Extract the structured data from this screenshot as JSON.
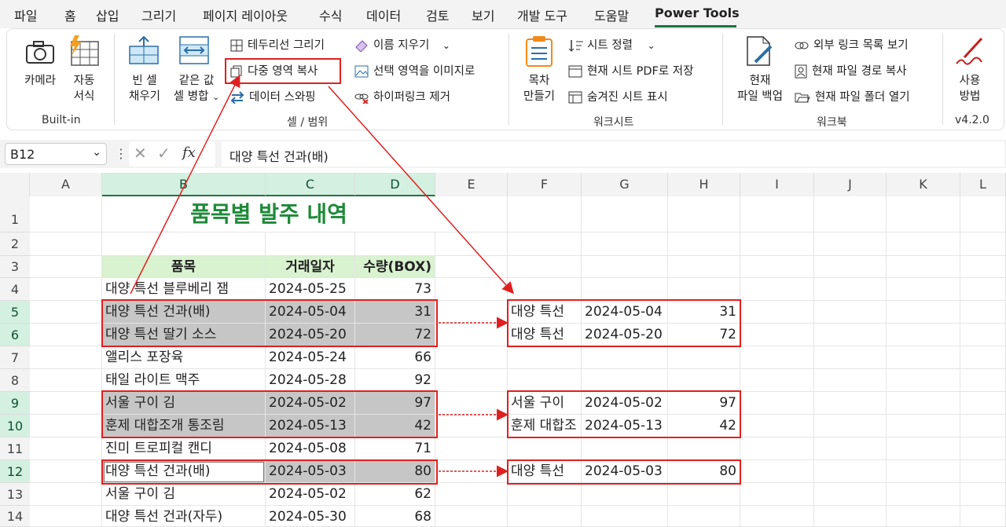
{
  "tabs": [
    "파일",
    "홈",
    "삽입",
    "그리기",
    "페이지 레이아웃",
    "수식",
    "데이터",
    "검토",
    "보기",
    "개발 도구",
    "도움말",
    "Power Tools"
  ],
  "ribbon": {
    "camera": "카메라",
    "auto_format": "자동\n서식",
    "builtin": "Built-in",
    "fill_blank_1": "빈 셀",
    "fill_blank_2": "채우기",
    "merge_same_1": "같은 값",
    "merge_same_2": "셀 병합",
    "border_draw": "테두리선 그리기",
    "multi_copy": "다중 영역 복사",
    "data_swap": "데이터 스와핑",
    "name_delete": "이름 지우기",
    "selection_image": "선택 영역을 이미지로",
    "hyperlink_remove": "하이퍼링크 제거",
    "cell_range": "셀 / 범위",
    "toc_1": "목차",
    "toc_2": "만들기",
    "sheet_sort": "시트 정렬",
    "pdf_save": "현재 시트 PDF로 저장",
    "hidden_show": "숨겨진 시트 표시",
    "worksheet": "워크시트",
    "backup_1": "현재",
    "backup_2": "파일 백업",
    "ext_links": "외부 링크 목록 보기",
    "path_copy": "현재 파일 경로 복사",
    "folder_open": "현재 파일 폴더 열기",
    "workbook": "워크북",
    "usage_1": "사용",
    "usage_2": "방법",
    "version": "v4.2.0"
  },
  "formula_bar": {
    "namebox": "B12",
    "fx": "fx",
    "value": "대양 특선 건과(배)"
  },
  "columns": [
    "A",
    "B",
    "C",
    "D",
    "E",
    "F",
    "G",
    "H",
    "I",
    "J",
    "K",
    "L"
  ],
  "rows": [
    "1",
    "2",
    "3",
    "4",
    "5",
    "6",
    "7",
    "8",
    "9",
    "10",
    "11",
    "12",
    "13",
    "14"
  ],
  "sheet_title": "품목별 발주 내역",
  "headers": [
    "품목",
    "거래일자",
    "수량(BOX)"
  ],
  "table": [
    [
      "대양 특선 블루베리 잼",
      "2024-05-25",
      "73"
    ],
    [
      "대양 특선 건과(배)",
      "2024-05-04",
      "31"
    ],
    [
      "대양 특선 딸기 소스",
      "2024-05-20",
      "72"
    ],
    [
      "앨리스 포장육",
      "2024-05-24",
      "66"
    ],
    [
      "태일 라이트 맥주",
      "2024-05-28",
      "92"
    ],
    [
      "서울 구이 김",
      "2024-05-02",
      "97"
    ],
    [
      "훈제 대합조개 통조림",
      "2024-05-13",
      "42"
    ],
    [
      "진미 트로피컬 캔디",
      "2024-05-08",
      "71"
    ],
    [
      "대양 특선 건과(배)",
      "2024-05-03",
      "80"
    ],
    [
      "서울 구이 김",
      "2024-05-02",
      "62"
    ],
    [
      "대양 특선 건과(자두)",
      "2024-05-30",
      "68"
    ]
  ],
  "pasted": [
    [
      "대양 특선",
      "2024-05-04",
      "31"
    ],
    [
      "대양 특선",
      "2024-05-20",
      "72"
    ],
    [
      "서울 구이",
      "2024-05-02",
      "97"
    ],
    [
      "훈제 대합조",
      "2024-05-13",
      "42"
    ],
    [
      "대양 특선",
      "2024-05-03",
      "80"
    ]
  ],
  "colors": {
    "accent": "#217346",
    "title": "#1f8a3a",
    "header_bg": "#d9f2d0",
    "highlight": "#e02020"
  }
}
